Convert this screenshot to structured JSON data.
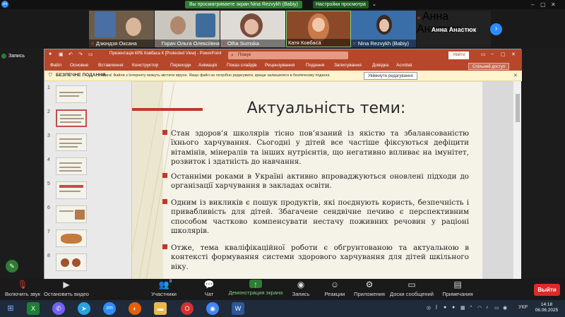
{
  "share_banner": {
    "viewing": "Вы просматриваете экран Nina Rezvykh (Babiy)",
    "settings": "Настройки просмотра",
    "zoom_logo": "zm"
  },
  "participants": [
    {
      "name": "Дзюндзя Оксана",
      "muted": true
    },
    {
      "name": "Горач Ольга Олексіївна",
      "muted": true
    },
    {
      "name": "Olha Sumska",
      "muted": true
    },
    {
      "name": "Катя Ковбаса",
      "muted": false
    },
    {
      "name": "Nina Rezvykh (Babiy)",
      "muted": true
    },
    {
      "name": "Анна Анастюк",
      "muted": true
    }
  ],
  "featured_name": "Анна Анастюк",
  "recording_label": "Запись",
  "ppt": {
    "title": "Презентація КРБ Ковбаса К [Protected View] - PowerPoint",
    "search_placeholder": "Пошук",
    "signin": "Увійти",
    "tabs": [
      "Файл",
      "Основне",
      "Вставлення",
      "Конструктор",
      "Переходи",
      "Анімація",
      "Показ слайдів",
      "Рецензування",
      "Подання",
      "Записування",
      "Довідка",
      "Acrobat"
    ],
    "shared_access": "Спільний доступ",
    "protected_label": "БЕЗПЕЧНЕ ПОДАННЯ",
    "protected_msg": "Увага! Файли з Інтернету можуть містити віруси. Якщо файл не потрібно редагувати, краще залишатися в безпечному поданні.",
    "enable_edit": "Увімкнути редагування",
    "thumb_numbers": [
      "1",
      "2",
      "3",
      "4",
      "5",
      "6",
      "7",
      "8"
    ]
  },
  "slide": {
    "title": "Актуальність теми:",
    "bullets": [
      "Стан здоров’я школярів тісно пов’язаний із якістю та збалансованістю їхнього харчування. Сьогодні у дітей все частіше фіксуються дефіцити вітамінів, мінералів та інших нутрієнтів, що негативно впливає на імунітет, розвиток і здатність до навчання.",
      "Останніми роками в Україні активно впроваджуються оновлені підходи до організації харчування в закладах освіти.",
      "Одним із викликів є пошук продуктів, які поєднують користь, безпечність і привабливість для дітей. Збагачене сендвічне печиво є перспективним способом частково компенсувати нестачу поживних речовин у раціоні школярів.",
      "Отже, тема кваліфікаційної роботи є обгрунтованою та актуальною в контексті формування системи здорового харчування для дітей шкільного віку."
    ]
  },
  "toolbar": {
    "mic": "Включить звук",
    "video": "Остановить видео",
    "participants": "Участники",
    "participants_count": "8",
    "chat": "Чат",
    "share": "Демонстрация экрана",
    "record": "Запись",
    "reactions": "Реакции",
    "apps": "Приложения",
    "whiteboard": "Доски сообщений",
    "notes": "Примечания",
    "leave": "Выйти"
  },
  "taskbar": {
    "lang": "УКР",
    "time": "14:18",
    "date": "06.06.2025"
  },
  "colors": {
    "ppt_red": "#b7472a",
    "zoom_blue": "#2d8cff",
    "share_green": "#2e7d32",
    "bullet_red": "#c0392b",
    "leave_red": "#e02828"
  }
}
